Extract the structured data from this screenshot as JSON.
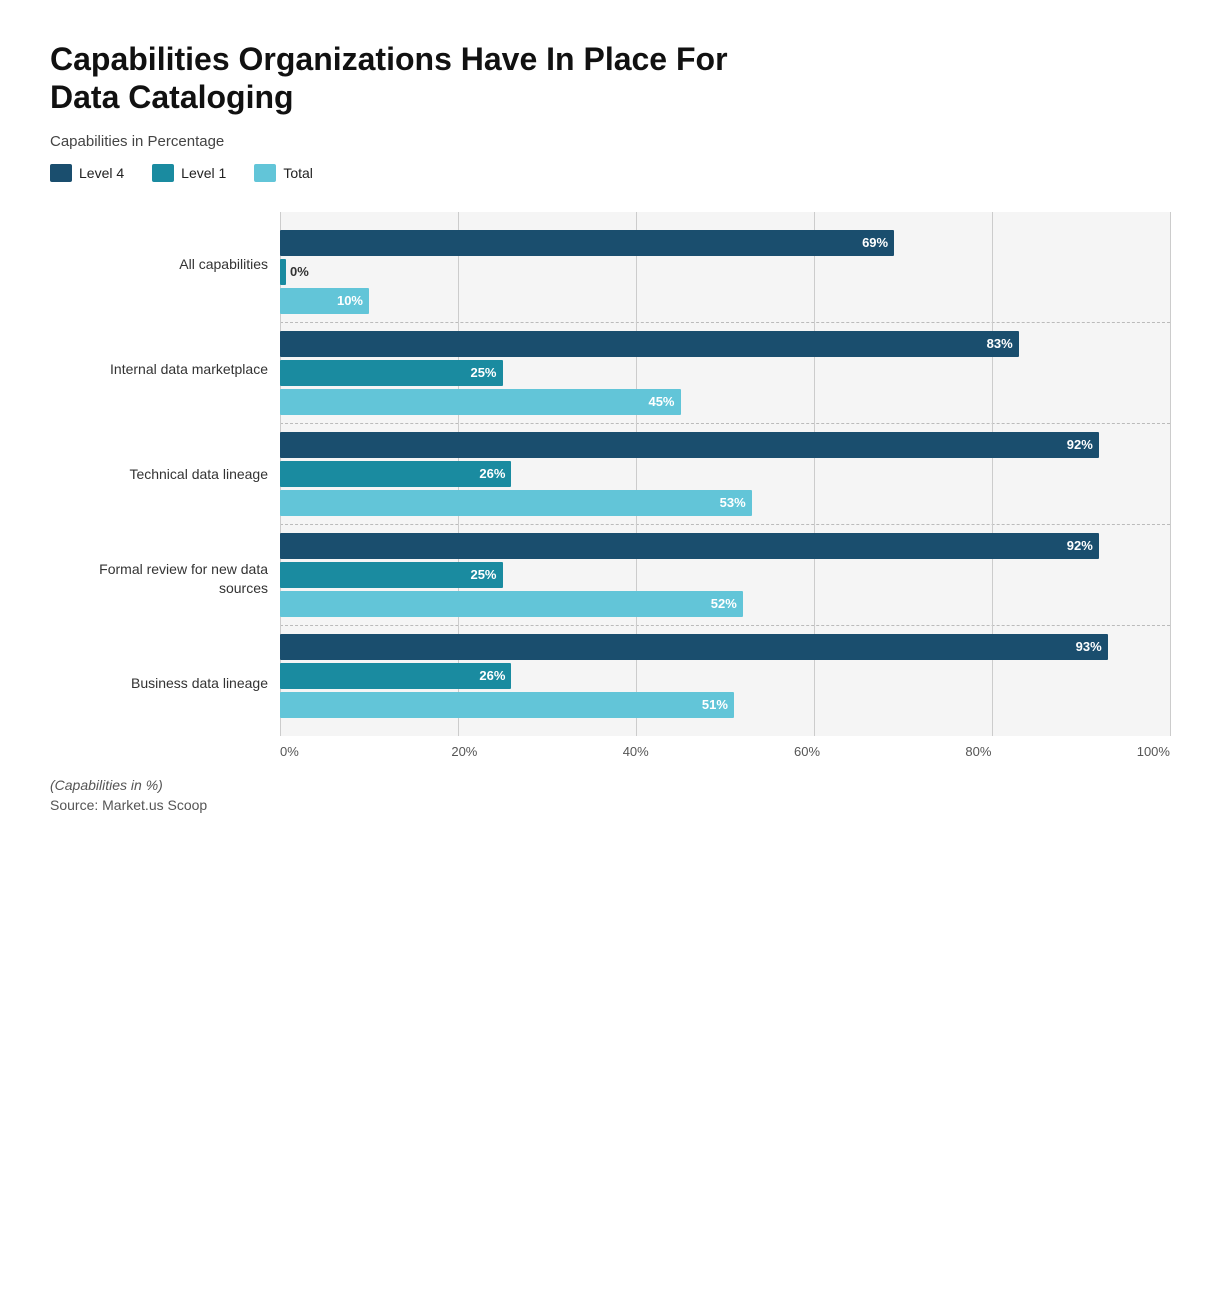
{
  "title": "Capabilities Organizations Have In Place For Data Cataloging",
  "subtitle": "Capabilities in Percentage",
  "legend": [
    {
      "label": "Level 4",
      "color": "#1a4e6e"
    },
    {
      "label": "Level 1",
      "color": "#1a8ba0"
    },
    {
      "label": "Total",
      "color": "#62c5d8"
    }
  ],
  "xAxis": {
    "ticks": [
      "0%",
      "20%",
      "40%",
      "60%",
      "80%",
      "100%"
    ]
  },
  "categories": [
    {
      "label": "All capabilities",
      "bars": [
        {
          "level": "Level 4",
          "value": 69,
          "color": "#1a4e6e",
          "label": "69%"
        },
        {
          "level": "Level 1",
          "value": 0,
          "color": "#1a8ba0",
          "label": "0%"
        },
        {
          "level": "Total",
          "value": 10,
          "color": "#62c5d8",
          "label": "10%"
        }
      ]
    },
    {
      "label": "Internal data marketplace",
      "bars": [
        {
          "level": "Level 4",
          "value": 83,
          "color": "#1a4e6e",
          "label": "83%"
        },
        {
          "level": "Level 1",
          "value": 25,
          "color": "#1a8ba0",
          "label": "25%"
        },
        {
          "level": "Total",
          "value": 45,
          "color": "#62c5d8",
          "label": "45%"
        }
      ]
    },
    {
      "label": "Technical data lineage",
      "bars": [
        {
          "level": "Level 4",
          "value": 92,
          "color": "#1a4e6e",
          "label": "92%"
        },
        {
          "level": "Level 1",
          "value": 26,
          "color": "#1a8ba0",
          "label": "26%"
        },
        {
          "level": "Total",
          "value": 53,
          "color": "#62c5d8",
          "label": "53%"
        }
      ]
    },
    {
      "label": "Formal review for new data sources",
      "bars": [
        {
          "level": "Level 4",
          "value": 92,
          "color": "#1a4e6e",
          "label": "92%"
        },
        {
          "level": "Level 1",
          "value": 25,
          "color": "#1a8ba0",
          "label": "25%"
        },
        {
          "level": "Total",
          "value": 52,
          "color": "#62c5d8",
          "label": "52%"
        }
      ]
    },
    {
      "label": "Business data lineage",
      "bars": [
        {
          "level": "Level 4",
          "value": 93,
          "color": "#1a4e6e",
          "label": "93%"
        },
        {
          "level": "Level 1",
          "value": 26,
          "color": "#1a8ba0",
          "label": "26%"
        },
        {
          "level": "Total",
          "value": 51,
          "color": "#62c5d8",
          "label": "51%"
        }
      ]
    }
  ],
  "footnote": "(Capabilities in %)",
  "source": "Source: Market.us Scoop"
}
